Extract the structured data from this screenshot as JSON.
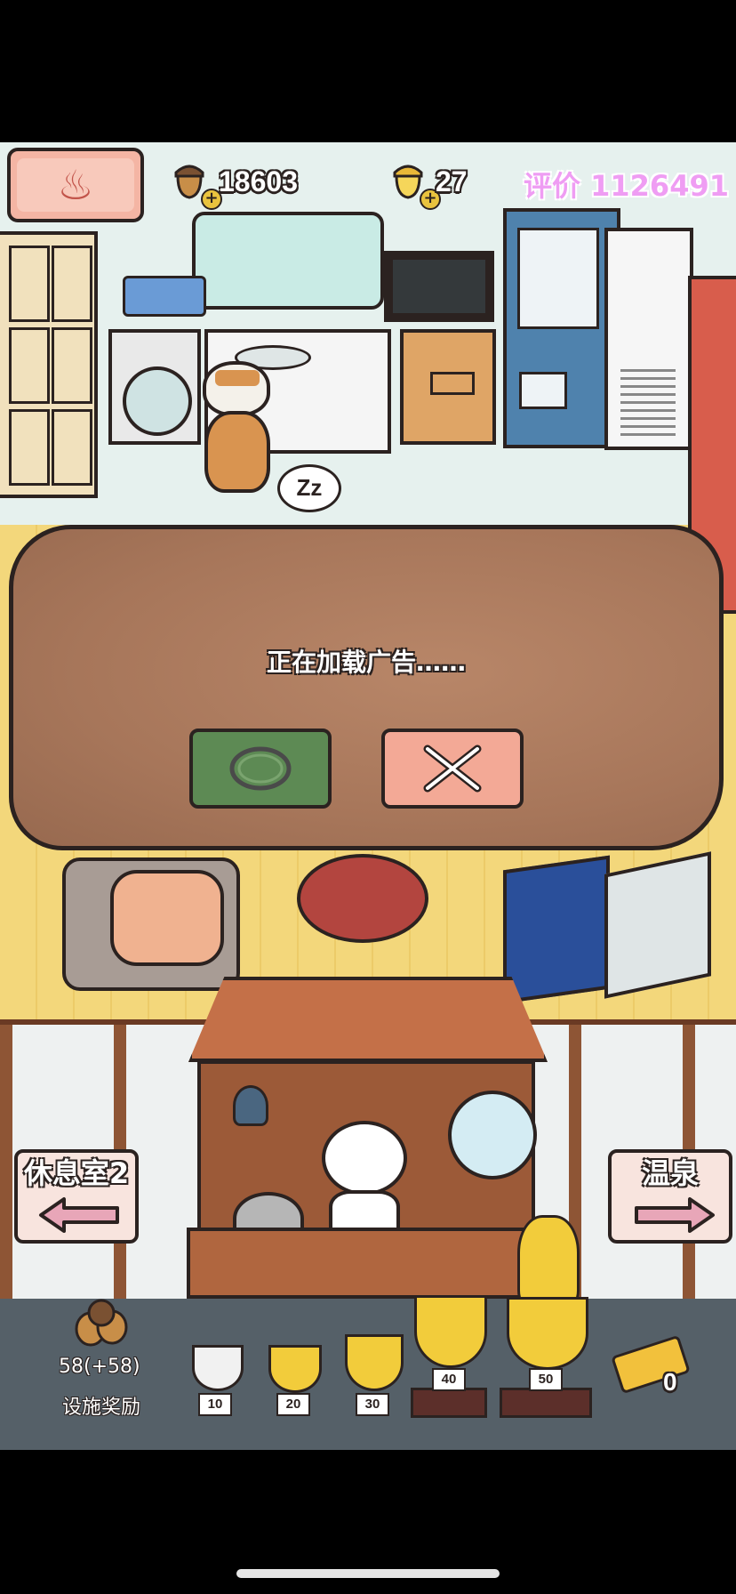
{
  "hud": {
    "acorns": "18603",
    "golden_acorns": "27",
    "rating": "评价 1126491"
  },
  "dialog": {
    "message": "正在加载广告……"
  },
  "nav": {
    "left_label": "休息室2",
    "right_label": "温泉"
  },
  "facility": {
    "reward_value": "58(+58)",
    "reward_label": "设施奖励"
  },
  "trophies": [
    "10",
    "20",
    "30",
    "40",
    "50"
  ],
  "tickets": "0",
  "sleep_bubble": "Zz",
  "colors": {
    "rating": "#ef9df3",
    "confirm_button": "#5d8a54",
    "cancel_button": "#f3a996",
    "dialog_wood": "#a7765a"
  }
}
